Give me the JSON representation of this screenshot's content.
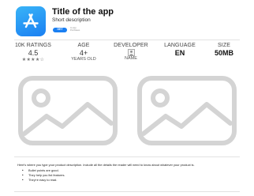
{
  "app": {
    "title": "Title of the app",
    "subtitle": "Short description",
    "get_label": "GET",
    "in_app_purchases": "In-App Purchases"
  },
  "stats": {
    "ratings": {
      "label": "10K RATINGS",
      "value": "4.5",
      "stars": "★★★★☆",
      "rating": 4.5
    },
    "age": {
      "label": "AGE",
      "value": "4+",
      "sub": "YEARS OLD"
    },
    "developer": {
      "label": "DEVELOPER",
      "sub": "NAME"
    },
    "language": {
      "label": "LANGUAGE",
      "value": "EN"
    },
    "size": {
      "label": "SIZE",
      "value": "50MB"
    }
  },
  "screenshots": [
    {
      "icon": "image-placeholder-icon"
    },
    {
      "icon": "image-placeholder-icon"
    }
  ],
  "description": {
    "intro": "Here's where you type your product description. Include all the details the reader will need to know about whatever your product is.",
    "bullets": [
      "Bullet points are good.",
      "They help you list features.",
      "They're easy to read."
    ]
  },
  "colors": {
    "accent": "#1a7ff2",
    "icon_gradient_top": "#39b4f7",
    "placeholder_stroke": "#d4d4d4"
  }
}
